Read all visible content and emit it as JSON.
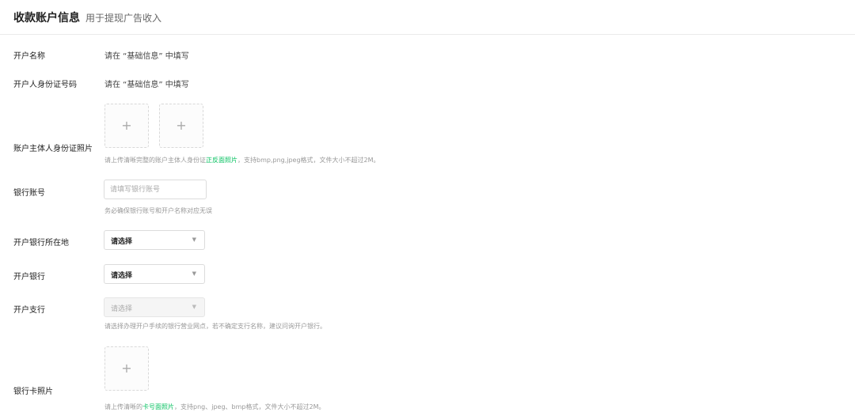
{
  "header": {
    "title": "收款账户信息",
    "subtitle": "用于提现广告收入"
  },
  "fields": {
    "account_name": {
      "label": "开户名称",
      "value": "请在 “基础信息” 中填写"
    },
    "id_number": {
      "label": "开户人身份证号码",
      "value": "请在 “基础信息” 中填写"
    },
    "id_photo": {
      "label": "账户主体人身份证照片",
      "upload_symbol": "+",
      "hint_prefix": "请上传清晰完整的账户主体人身份证",
      "hint_highlight": "正反面照片",
      "hint_suffix": "，支持bmp,png,jpeg格式，文件大小不超过2M。"
    },
    "bank_account": {
      "label": "银行账号",
      "placeholder": "请填写银行账号",
      "value": "",
      "hint": "务必确保银行账号和开户名称对应无误"
    },
    "bank_location": {
      "label": "开户银行所在地",
      "selected": "请选择"
    },
    "bank": {
      "label": "开户银行",
      "selected": "请选择"
    },
    "branch": {
      "label": "开户支行",
      "selected": "请选择",
      "disabled": true,
      "hint": "请选择办理开户手续的银行营业网点，若不确定支行名称，建议问询开户银行。"
    },
    "card_photo": {
      "label": "银行卡照片",
      "upload_symbol": "+",
      "hint_prefix": "请上传清晰的",
      "hint_highlight": "卡号面照片",
      "hint_suffix": "，支持png、jpeg、bmp格式，文件大小不超过2M。"
    }
  },
  "icons": {
    "caret": "▼",
    "plus": "plus-icon",
    "caret_name": "caret-down-icon"
  },
  "colors": {
    "accent": "#07c160",
    "border": "#dcdcdc",
    "hint": "#999999"
  }
}
